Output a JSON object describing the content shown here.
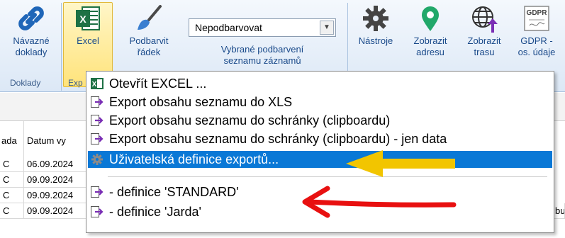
{
  "ribbon": {
    "navazne_doklady": [
      "Návazné",
      "doklady"
    ],
    "excel": "Excel",
    "podbarvit": [
      "Podbarvit",
      "řádek"
    ],
    "select_value": "Nepodbarvovat",
    "vybrane": [
      "Vybrané podbarvení",
      "seznamu záznamů"
    ],
    "nastroje": "Nástroje",
    "zobrazit_adresu": [
      "Zobrazit",
      "adresu"
    ],
    "zobrazit_trasu": [
      "Zobrazit",
      "trasu"
    ],
    "gdpr": [
      "GDPR -",
      "os. údaje"
    ],
    "gdpr_badge": "GDPR",
    "group_doklady": "Doklady",
    "group_exp": "Exp"
  },
  "grid": {
    "headers": [
      "ada",
      "Datum vy"
    ],
    "rows": [
      {
        "c1": "C",
        "c2": "06.09.2024"
      },
      {
        "c1": "C",
        "c2": "09.09.2024"
      },
      {
        "c1": "C",
        "c2": "09.09.2024"
      },
      {
        "c1": "C",
        "c2": "09.09.2024"
      }
    ],
    "edge_text": "bu"
  },
  "menu": {
    "items": [
      "Otevřít EXCEL ...",
      "Export obsahu seznamu do XLS",
      "Export obsahu seznamu do schránky (clipboardu)",
      "Export obsahu seznamu do schránky (clipboardu) - jen data",
      "Uživatelská definice exportů...",
      " - definice 'STANDARD'",
      " - definice 'Jarda'"
    ],
    "highlight_index": 4
  },
  "colors": {
    "highlight": "#0a78d6",
    "yellow_arrow": "#f2c500",
    "red_arrow": "#e81010",
    "ribbon_text": "#1a4a8a"
  }
}
